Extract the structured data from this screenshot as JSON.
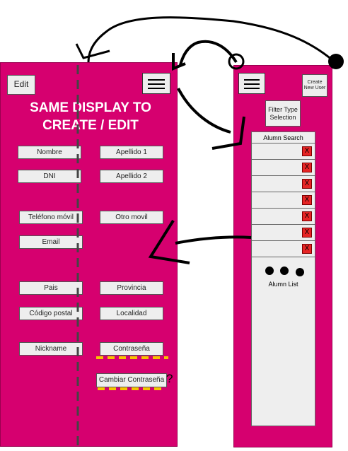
{
  "left": {
    "edit_label": "Edit",
    "title": "SAME DISPLAY TO CREATE / EDIT",
    "fields": {
      "nombre": "Nombre",
      "apellido1": "Apellido 1",
      "dni": "DNI",
      "apellido2": "Apellido 2",
      "telefono": "Teléfono móvil",
      "otro": "Otro movil",
      "email": "Email",
      "pais": "Pais",
      "provincia": "Provincia",
      "codigo_postal": "Código postal",
      "localidad": "Localidad",
      "nickname": "Nickname",
      "contrasena": "Contraseña",
      "cambiar": "Cambiar Contraseña"
    },
    "question_mark": "?"
  },
  "right": {
    "create_label": "Create New User",
    "filter_label": "Filter Type Selection",
    "list_header": "Alumn Search",
    "delete_glyph": "X",
    "row_count": 7,
    "list_footer": "Alumn List"
  },
  "colors": {
    "panel": "#d6006f",
    "button": "#eeeeee",
    "delete": "#e62424",
    "highlight": "#f5c400"
  }
}
